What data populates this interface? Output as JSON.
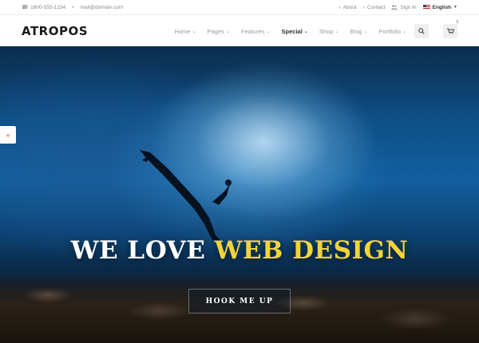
{
  "topbar": {
    "phone": "1800-555-1234",
    "email": "mail@domain.com",
    "about": "About",
    "contact": "Contact",
    "sign_in": "Sign In",
    "language": "English"
  },
  "header": {
    "logo": "ATROPOS",
    "nav": [
      {
        "label": "Home",
        "active": false
      },
      {
        "label": "Pages",
        "active": false
      },
      {
        "label": "Features",
        "active": false
      },
      {
        "label": "Special",
        "active": true
      },
      {
        "label": "Shop",
        "active": false
      },
      {
        "label": "Blog",
        "active": false
      },
      {
        "label": "Portfolio",
        "active": false
      }
    ],
    "cart_count": "3"
  },
  "hero": {
    "headline_white": "WE LOVE",
    "headline_yellow": "WEB DESIGN",
    "cta": "HOOK ME UP",
    "side_tab": "»"
  },
  "colors": {
    "accent_yellow": "#f2d43a",
    "side_tab_icon": "#e0553a"
  },
  "icons": {
    "phone": "phone-icon",
    "chevron": "chevron-right-icon",
    "user": "user-icon",
    "flag": "us-flag-icon",
    "search": "search-icon",
    "cart": "cart-icon"
  }
}
